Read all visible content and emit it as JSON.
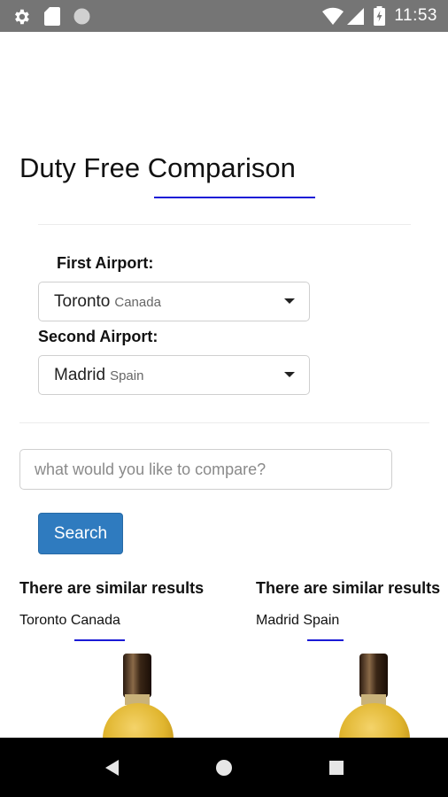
{
  "status_bar": {
    "time": "11:53",
    "left_icons": [
      "gear-icon",
      "sd-card-icon",
      "circle-icon"
    ],
    "right_icons": [
      "wifi-icon",
      "signal-icon",
      "battery-icon"
    ]
  },
  "page": {
    "title": "Duty Free Comparison",
    "accent_color": "#1a1ad6"
  },
  "form": {
    "first_airport": {
      "label": "First Airport:",
      "city": "Toronto",
      "country": "Canada"
    },
    "second_airport": {
      "label": "Second Airport:",
      "city": "Madrid",
      "country": "Spain"
    },
    "search": {
      "placeholder": "what would you like to compare?",
      "value": ""
    },
    "search_button_label": "Search",
    "button_color": "#2f7bbf"
  },
  "results": [
    {
      "heading": "There are similar results",
      "location": "Toronto Canada",
      "product_icon": "perfume-bottle-image"
    },
    {
      "heading": "There are similar results",
      "location": "Madrid Spain",
      "product_icon": "perfume-bottle-image"
    }
  ],
  "nav_bar": {
    "buttons": [
      "back-icon",
      "home-icon",
      "recents-icon"
    ]
  }
}
